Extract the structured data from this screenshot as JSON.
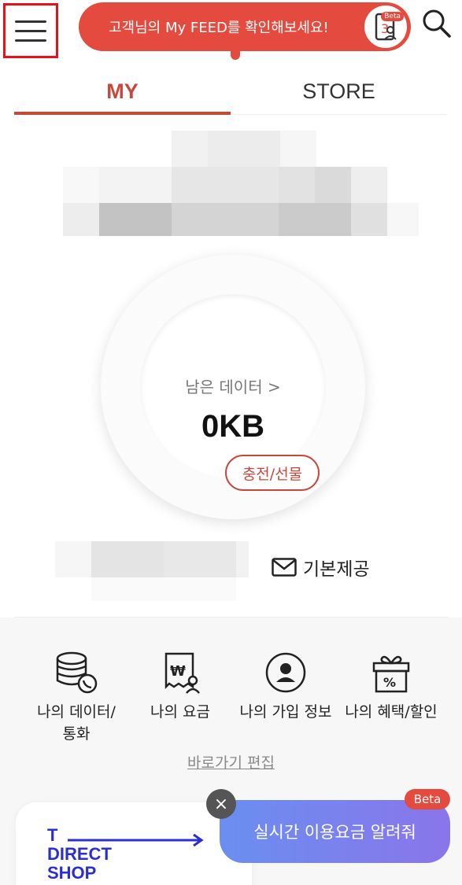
{
  "header": {
    "feed_banner_text": "고객님의 My FEED를 확인해보세요!",
    "feed_badge": "Beta",
    "icons": {
      "menu": "hamburger-menu-icon",
      "search": "search-icon",
      "feed": "feed-profile-icon"
    }
  },
  "tabs": [
    {
      "label": "MY",
      "active": true
    },
    {
      "label": "STORE",
      "active": false
    }
  ],
  "data_ring": {
    "label": "남은 데이터 >",
    "value": "0KB",
    "charge_button": "충전/선물"
  },
  "basic_offer": {
    "label": "기본제공",
    "icon": "mail-icon"
  },
  "shortcuts": [
    {
      "label": "나의 데이터/\n통화",
      "icon": "data-call-icon"
    },
    {
      "label": "나의 요금",
      "icon": "bill-icon"
    },
    {
      "label": "나의 가입 정보",
      "icon": "user-info-icon"
    },
    {
      "label": "나의 혜택/할인",
      "icon": "gift-discount-icon"
    }
  ],
  "shortcut_edit_link": "바로가기 편집",
  "direct_shop": {
    "line1": "T",
    "line2": "DIRECT",
    "line3": "SHOP"
  },
  "realtime_popup": {
    "text": "실시간 이용요금 알려줘",
    "badge": "Beta",
    "close": "×"
  },
  "colors": {
    "accent": "#e54a3f",
    "tab_active": "#c8473d",
    "direct_shop_blue": "#2b2fd0"
  }
}
